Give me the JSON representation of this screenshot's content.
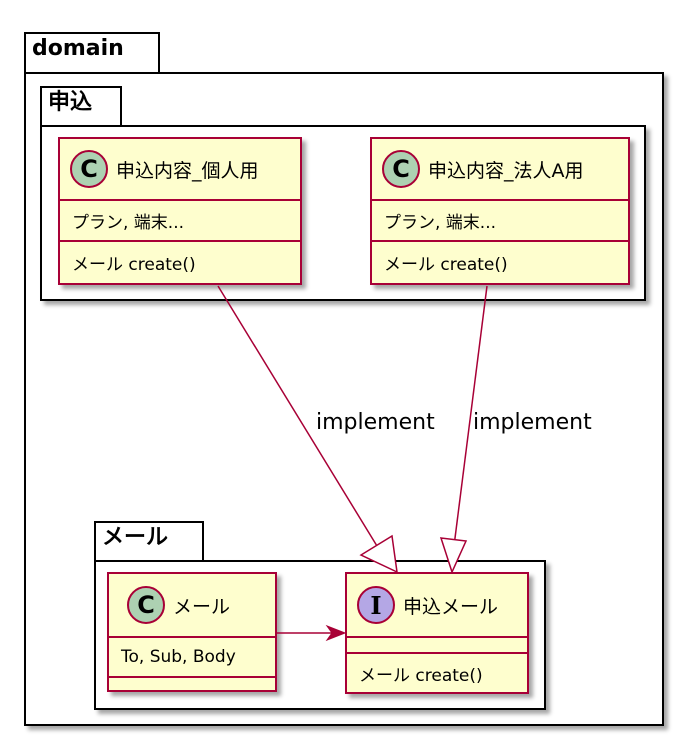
{
  "packages": {
    "domain": {
      "name": "domain"
    },
    "moushikomi": {
      "name": "申込"
    },
    "mail": {
      "name": "メール"
    }
  },
  "classes": {
    "kojin": {
      "stereotype": "C",
      "name": "申込内容_個人用",
      "attributes": "プラン, 端末...",
      "methods": "メール create()"
    },
    "houjin": {
      "stereotype": "C",
      "name": "申込内容_法人A用",
      "attributes": "プラン, 端末...",
      "methods": "メール create()"
    },
    "mail_class": {
      "stereotype": "C",
      "name": "メール",
      "attributes": "To, Sub, Body",
      "methods": ""
    },
    "mail_interface": {
      "stereotype": "I",
      "name": "申込メール",
      "attributes": "",
      "methods": "メール create()"
    }
  },
  "relations": {
    "kojin_impl": {
      "label": "implement"
    },
    "houjin_impl": {
      "label": "implement"
    }
  },
  "colors": {
    "class_fill": "#FEFECE",
    "class_border": "#A80036",
    "class_badge": "#ADD1B2",
    "interface_badge": "#B4A7E5"
  }
}
